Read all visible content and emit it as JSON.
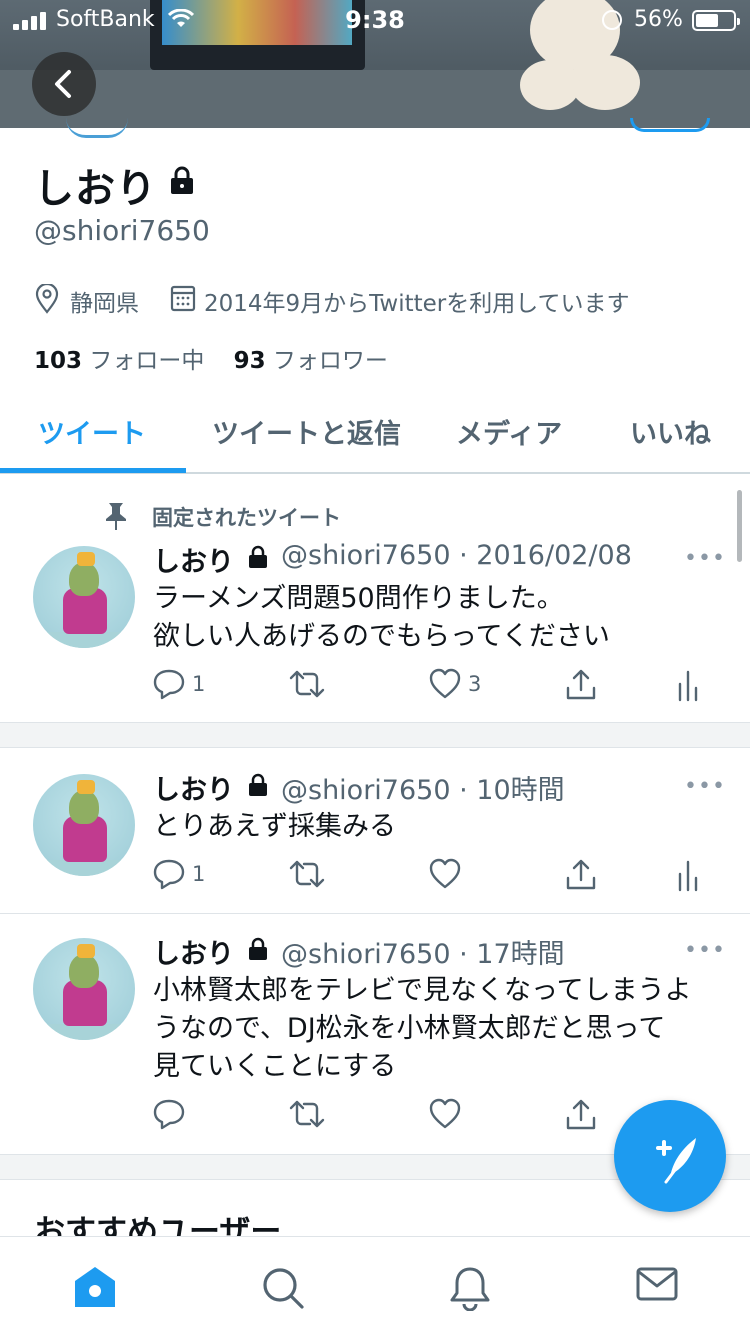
{
  "status_bar": {
    "carrier": "SoftBank",
    "time": "9:38",
    "battery_percent": "56%"
  },
  "profile": {
    "name": "しおり",
    "handle": "@shiori7650",
    "location": "静岡県",
    "joined": "2014年9月からTwitterを利用しています",
    "following_count": "103",
    "following_label": "フォロー中",
    "followers_count": "93",
    "followers_label": "フォロワー"
  },
  "tabs": [
    {
      "label": "ツイート",
      "active": true
    },
    {
      "label": "ツイートと返信",
      "active": false
    },
    {
      "label": "メディア",
      "active": false
    },
    {
      "label": "いいね",
      "active": false
    }
  ],
  "pinned_label": "固定されたツイート",
  "tweets": [
    {
      "name": "しおり",
      "meta": "@shiori7650 · 2016/02/08",
      "text_lines": [
        "ラーメンズ問題50問作りました。",
        "欲しい人あげるのでもらってください"
      ],
      "replies": "1",
      "likes": "3"
    },
    {
      "name": "しおり",
      "meta": "@shiori7650 · 10時間",
      "text_lines": [
        "とりあえず採集みる"
      ],
      "replies": "1",
      "likes": ""
    },
    {
      "name": "しおり",
      "meta": "@shiori7650 · 17時間",
      "text_lines": [
        "小林賢太郎をテレビで見なくなってしまうよ",
        "うなので、DJ松永を小林賢太郎だと思って",
        "見ていくことにする"
      ],
      "replies": "",
      "likes": ""
    }
  ],
  "recommend_heading": "おすすめユーザー",
  "colors": {
    "accent": "#1d9bf0",
    "secondary_text": "#536471"
  },
  "icons": [
    "back-arrow-icon",
    "lock-icon",
    "location-pin-icon",
    "calendar-icon",
    "pin-icon",
    "reply-icon",
    "retweet-icon",
    "like-icon",
    "share-icon",
    "analytics-icon",
    "compose-tweet-icon",
    "home-icon",
    "search-icon",
    "notifications-icon",
    "messages-icon"
  ]
}
